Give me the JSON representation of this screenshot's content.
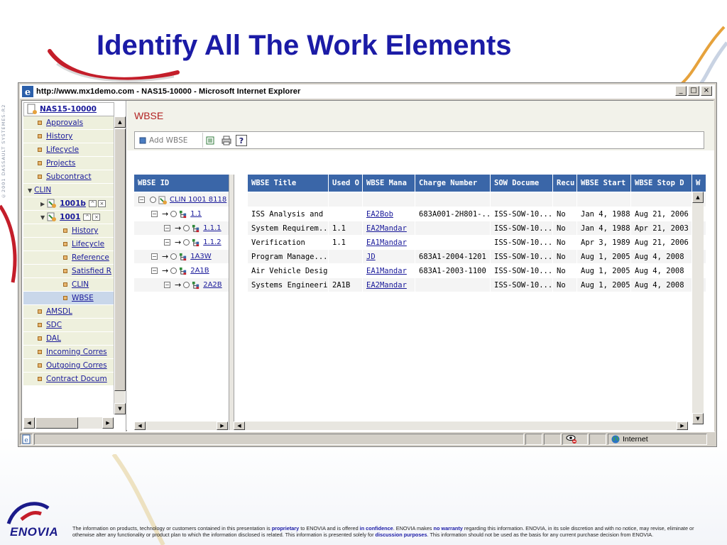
{
  "slide": {
    "title": "Identify All The Work Elements",
    "vertical_text": "©2001 DASSAULT SYSTEMES-R2",
    "logo_text": "ENOVIA",
    "disclaimer_parts": [
      "The information on products, technology or customers contained in this presentation is ",
      "proprietary",
      " to ENOVIA and is offered ",
      "in confidence",
      ".  ENOVIA makes ",
      "no warranty",
      " regarding this information. ENOVIA, in its sole discretion and with no notice, may revise, eliminate or otherwise alter any functionality or product plan to which the information disclosed is related. This information is presented solely for ",
      "discussion purposes",
      ". This information should not be used as the basis for any current purchase decision from ENOVIA."
    ]
  },
  "browser": {
    "window_title": "http://www.mx1demo.com - NAS15-10000 - Microsoft Internet Explorer",
    "buttons": {
      "minimize": "_",
      "maximize": "□",
      "close": "×"
    },
    "status_zone": "Internet"
  },
  "left_tree": {
    "root": "NAS15-10000",
    "items": [
      {
        "label": "Approvals",
        "indent": 1
      },
      {
        "label": "History",
        "indent": 1
      },
      {
        "label": "Lifecycle",
        "indent": 1
      },
      {
        "label": "Projects",
        "indent": 1
      },
      {
        "label": "Subcontract",
        "indent": 1
      },
      {
        "label": "CLIN",
        "indent": 0,
        "expanded": true
      },
      {
        "label": "1001b",
        "indent": 1,
        "bold": true,
        "node": true,
        "collapsed": true
      },
      {
        "label": "1001",
        "indent": 1,
        "bold": true,
        "node": true,
        "expanded": true
      },
      {
        "label": "History",
        "indent": 2
      },
      {
        "label": "Lifecycle",
        "indent": 2
      },
      {
        "label": "Reference",
        "indent": 2
      },
      {
        "label": "Satisfied R",
        "indent": 2
      },
      {
        "label": "CLIN",
        "indent": 2
      },
      {
        "label": "WBSE",
        "indent": 2,
        "selected": true
      },
      {
        "label": "AMSDL",
        "indent": 1
      },
      {
        "label": "SDC",
        "indent": 1
      },
      {
        "label": "DAL",
        "indent": 1
      },
      {
        "label": "Incoming Corres",
        "indent": 1
      },
      {
        "label": "Outgoing Corres",
        "indent": 1
      },
      {
        "label": "Contract Docum",
        "indent": 1
      }
    ]
  },
  "wbse_page": {
    "heading": "WBSE",
    "toolbar": {
      "add_label": "Add WBSE"
    },
    "tree_header": "WBSE ID",
    "columns": [
      "WBSE Title",
      "Used O",
      "WBSE Mana",
      "Charge Number",
      "SOW Docume",
      "Recu",
      "WBSE Start",
      "WBSE Stop D",
      "W"
    ],
    "tree_rows": [
      {
        "id": "CLIN 1001 8118",
        "level": 0
      },
      {
        "id": "1.1",
        "level": 1
      },
      {
        "id": "1.1.1",
        "level": 2
      },
      {
        "id": "1.1.2",
        "level": 2
      },
      {
        "id": "1A3W",
        "level": 1
      },
      {
        "id": "2A1B",
        "level": 1
      },
      {
        "id": "2A2B",
        "level": 2
      }
    ],
    "rows": [
      [
        "",
        "",
        "",
        "",
        "",
        "",
        "",
        "",
        ""
      ],
      [
        "ISS Analysis and I...",
        "",
        "EA2Bob",
        "683A001-2H801-...",
        "ISS-SOW-10...",
        "No",
        "Jan 4, 1988",
        "Aug 21, 2006",
        ""
      ],
      [
        "System Requirem...",
        "1.1",
        "EA2Mandar",
        "",
        "ISS-SOW-10...",
        "No",
        "Jan 4, 1988",
        "Apr 21, 2003",
        ""
      ],
      [
        "Verification",
        "1.1",
        "EA1Mandar",
        "",
        "ISS-SOW-10...",
        "No",
        "Apr 3, 1989",
        "Aug 21, 2006",
        ""
      ],
      [
        "Program Manage...",
        "",
        "JD",
        "683A1-2004-1201",
        "ISS-SOW-10...",
        "No",
        "Aug 1, 2005",
        "Aug 4, 2008",
        ""
      ],
      [
        "Air Vehicle Design",
        "",
        "EA1Mandar",
        "683A1-2003-1100",
        "ISS-SOW-10...",
        "No",
        "Aug 1, 2005",
        "Aug 4, 2008",
        ""
      ],
      [
        "Systems Engineeri...",
        "2A1B",
        "EA2Mandar",
        "",
        "ISS-SOW-10...",
        "No",
        "Aug 1, 2005",
        "Aug 4, 2008",
        ""
      ]
    ]
  }
}
